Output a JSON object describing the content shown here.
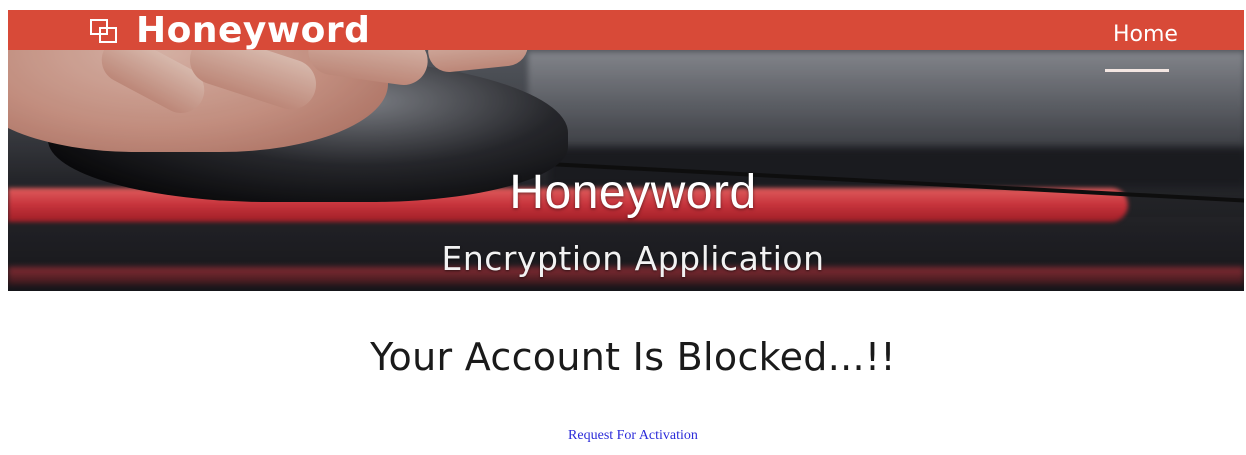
{
  "navbar": {
    "brand": "Honeyword",
    "home_label": "Home",
    "brand_color": "#d84a38"
  },
  "hero": {
    "title": "Honeyword",
    "subtitle": "Encryption Application"
  },
  "main": {
    "heading": "Your Account Is Blocked...!!",
    "activation_link": "Request For Activation",
    "link_color": "#2b2bd9"
  },
  "icons": {
    "brand": "overlapping-squares-icon"
  }
}
